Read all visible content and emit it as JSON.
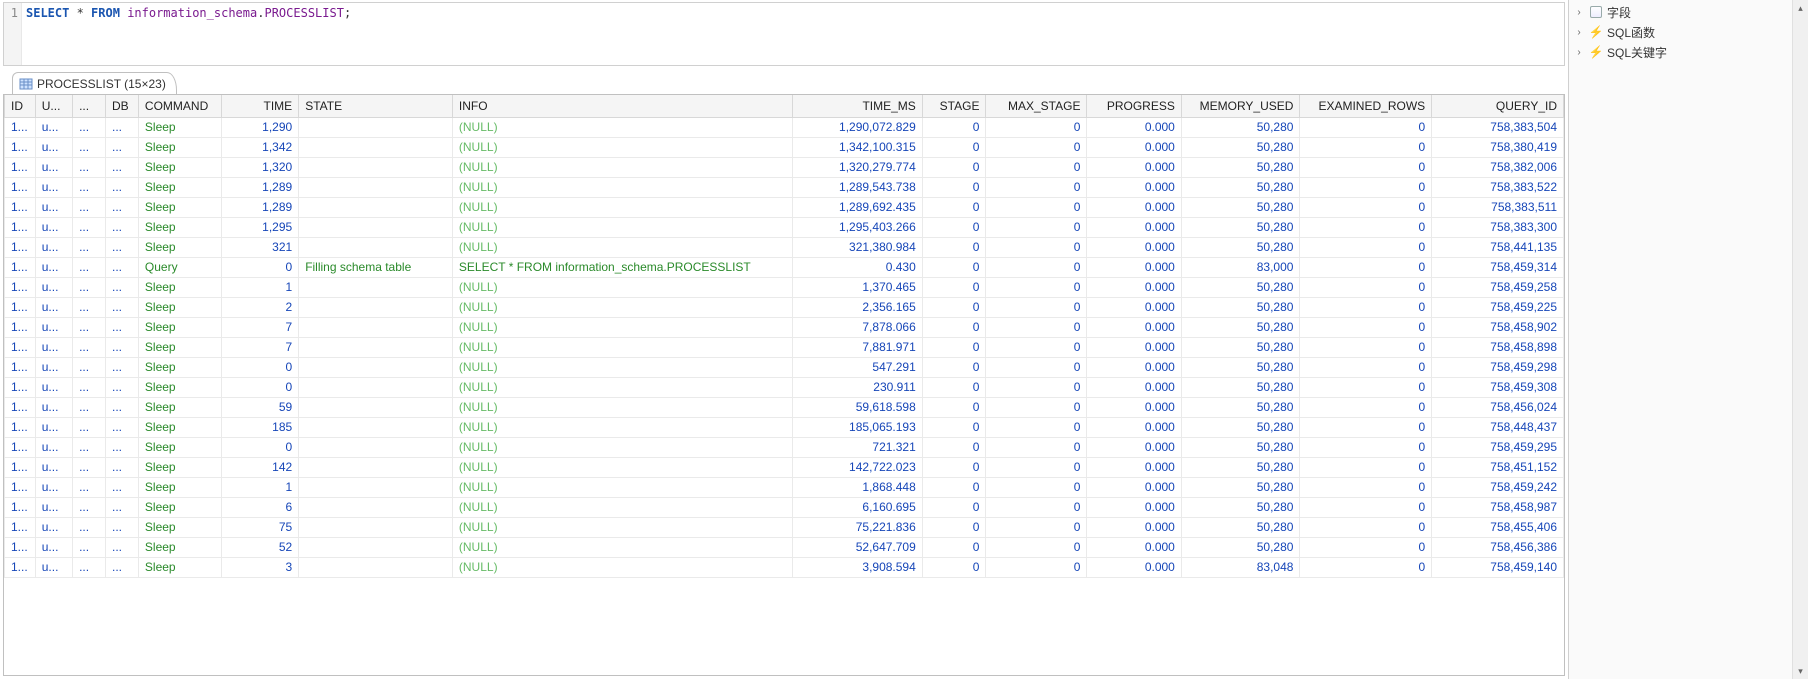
{
  "editor": {
    "line_number": "1",
    "kw_select": "SELECT",
    "star": " * ",
    "kw_from": "FROM",
    "space": " ",
    "id_schema": "information_schema",
    "dot": ".",
    "id_table": "PROCESSLIST",
    "semi": ";"
  },
  "tab": {
    "label": "PROCESSLIST (15×23)"
  },
  "sidebar": {
    "items": [
      {
        "label": "字段",
        "icon": "db"
      },
      {
        "label": "SQL函数",
        "icon": "bolt"
      },
      {
        "label": "SQL关键字",
        "icon": "bolt"
      }
    ]
  },
  "columns": [
    "ID",
    "U...",
    "...",
    "DB",
    "COMMAND",
    "TIME",
    "STATE",
    "INFO",
    "TIME_MS",
    "STAGE",
    "MAX_STAGE",
    "PROGRESS",
    "MEMORY_USED",
    "EXAMINED_ROWS",
    "QUERY_ID"
  ],
  "rows": [
    {
      "id": "1...",
      "u": "u...",
      "b1": "...",
      "b2": "...",
      "cmd": "Sleep",
      "time": "1,290",
      "state": "",
      "info": "(NULL)",
      "info_null": true,
      "tms": "1,290,072.829",
      "stage": "0",
      "max": "0",
      "prog": "0.000",
      "mem": "50,280",
      "exr": "0",
      "qid": "758,383,504"
    },
    {
      "id": "1...",
      "u": "u...",
      "b1": "...",
      "b2": "...",
      "cmd": "Sleep",
      "time": "1,342",
      "state": "",
      "info": "(NULL)",
      "info_null": true,
      "tms": "1,342,100.315",
      "stage": "0",
      "max": "0",
      "prog": "0.000",
      "mem": "50,280",
      "exr": "0",
      "qid": "758,380,419"
    },
    {
      "id": "1...",
      "u": "u...",
      "b1": "...",
      "b2": "...",
      "cmd": "Sleep",
      "time": "1,320",
      "state": "",
      "info": "(NULL)",
      "info_null": true,
      "tms": "1,320,279.774",
      "stage": "0",
      "max": "0",
      "prog": "0.000",
      "mem": "50,280",
      "exr": "0",
      "qid": "758,382,006"
    },
    {
      "id": "1...",
      "u": "u...",
      "b1": "...",
      "b2": "...",
      "cmd": "Sleep",
      "time": "1,289",
      "state": "",
      "info": "(NULL)",
      "info_null": true,
      "tms": "1,289,543.738",
      "stage": "0",
      "max": "0",
      "prog": "0.000",
      "mem": "50,280",
      "exr": "0",
      "qid": "758,383,522"
    },
    {
      "id": "1...",
      "u": "u...",
      "b1": "...",
      "b2": "...",
      "cmd": "Sleep",
      "time": "1,289",
      "state": "",
      "info": "(NULL)",
      "info_null": true,
      "tms": "1,289,692.435",
      "stage": "0",
      "max": "0",
      "prog": "0.000",
      "mem": "50,280",
      "exr": "0",
      "qid": "758,383,511"
    },
    {
      "id": "1...",
      "u": "u...",
      "b1": "...",
      "b2": "...",
      "cmd": "Sleep",
      "time": "1,295",
      "state": "",
      "info": "(NULL)",
      "info_null": true,
      "tms": "1,295,403.266",
      "stage": "0",
      "max": "0",
      "prog": "0.000",
      "mem": "50,280",
      "exr": "0",
      "qid": "758,383,300"
    },
    {
      "id": "1...",
      "u": "u...",
      "b1": "...",
      "b2": "...",
      "cmd": "Sleep",
      "time": "321",
      "state": "",
      "info": "(NULL)",
      "info_null": true,
      "tms": "321,380.984",
      "stage": "0",
      "max": "0",
      "prog": "0.000",
      "mem": "50,280",
      "exr": "0",
      "qid": "758,441,135"
    },
    {
      "id": "1...",
      "u": "u...",
      "b1": "...",
      "b2": "...",
      "cmd": "Query",
      "time": "0",
      "state": "Filling schema table",
      "info": "SELECT * FROM information_schema.PROCESSLIST",
      "info_null": false,
      "tms": "0.430",
      "stage": "0",
      "max": "0",
      "prog": "0.000",
      "mem": "83,000",
      "exr": "0",
      "qid": "758,459,314"
    },
    {
      "id": "1...",
      "u": "u...",
      "b1": "...",
      "b2": "...",
      "cmd": "Sleep",
      "time": "1",
      "state": "",
      "info": "(NULL)",
      "info_null": true,
      "tms": "1,370.465",
      "stage": "0",
      "max": "0",
      "prog": "0.000",
      "mem": "50,280",
      "exr": "0",
      "qid": "758,459,258"
    },
    {
      "id": "1...",
      "u": "u...",
      "b1": "...",
      "b2": "...",
      "cmd": "Sleep",
      "time": "2",
      "state": "",
      "info": "(NULL)",
      "info_null": true,
      "tms": "2,356.165",
      "stage": "0",
      "max": "0",
      "prog": "0.000",
      "mem": "50,280",
      "exr": "0",
      "qid": "758,459,225"
    },
    {
      "id": "1...",
      "u": "u...",
      "b1": "...",
      "b2": "...",
      "cmd": "Sleep",
      "time": "7",
      "state": "",
      "info": "(NULL)",
      "info_null": true,
      "tms": "7,878.066",
      "stage": "0",
      "max": "0",
      "prog": "0.000",
      "mem": "50,280",
      "exr": "0",
      "qid": "758,458,902"
    },
    {
      "id": "1...",
      "u": "u...",
      "b1": "...",
      "b2": "...",
      "cmd": "Sleep",
      "time": "7",
      "state": "",
      "info": "(NULL)",
      "info_null": true,
      "tms": "7,881.971",
      "stage": "0",
      "max": "0",
      "prog": "0.000",
      "mem": "50,280",
      "exr": "0",
      "qid": "758,458,898"
    },
    {
      "id": "1...",
      "u": "u...",
      "b1": "...",
      "b2": "...",
      "cmd": "Sleep",
      "time": "0",
      "state": "",
      "info": "(NULL)",
      "info_null": true,
      "tms": "547.291",
      "stage": "0",
      "max": "0",
      "prog": "0.000",
      "mem": "50,280",
      "exr": "0",
      "qid": "758,459,298"
    },
    {
      "id": "1...",
      "u": "u...",
      "b1": "...",
      "b2": "...",
      "cmd": "Sleep",
      "time": "0",
      "state": "",
      "info": "(NULL)",
      "info_null": true,
      "tms": "230.911",
      "stage": "0",
      "max": "0",
      "prog": "0.000",
      "mem": "50,280",
      "exr": "0",
      "qid": "758,459,308"
    },
    {
      "id": "1...",
      "u": "u...",
      "b1": "...",
      "b2": "...",
      "cmd": "Sleep",
      "time": "59",
      "state": "",
      "info": "(NULL)",
      "info_null": true,
      "tms": "59,618.598",
      "stage": "0",
      "max": "0",
      "prog": "0.000",
      "mem": "50,280",
      "exr": "0",
      "qid": "758,456,024"
    },
    {
      "id": "1...",
      "u": "u...",
      "b1": "...",
      "b2": "...",
      "cmd": "Sleep",
      "time": "185",
      "state": "",
      "info": "(NULL)",
      "info_null": true,
      "tms": "185,065.193",
      "stage": "0",
      "max": "0",
      "prog": "0.000",
      "mem": "50,280",
      "exr": "0",
      "qid": "758,448,437"
    },
    {
      "id": "1...",
      "u": "u...",
      "b1": "...",
      "b2": "...",
      "cmd": "Sleep",
      "time": "0",
      "state": "",
      "info": "(NULL)",
      "info_null": true,
      "tms": "721.321",
      "stage": "0",
      "max": "0",
      "prog": "0.000",
      "mem": "50,280",
      "exr": "0",
      "qid": "758,459,295"
    },
    {
      "id": "1...",
      "u": "u...",
      "b1": "...",
      "b2": "...",
      "cmd": "Sleep",
      "time": "142",
      "state": "",
      "info": "(NULL)",
      "info_null": true,
      "tms": "142,722.023",
      "stage": "0",
      "max": "0",
      "prog": "0.000",
      "mem": "50,280",
      "exr": "0",
      "qid": "758,451,152"
    },
    {
      "id": "1...",
      "u": "u...",
      "b1": "...",
      "b2": "...",
      "cmd": "Sleep",
      "time": "1",
      "state": "",
      "info": "(NULL)",
      "info_null": true,
      "tms": "1,868.448",
      "stage": "0",
      "max": "0",
      "prog": "0.000",
      "mem": "50,280",
      "exr": "0",
      "qid": "758,459,242"
    },
    {
      "id": "1...",
      "u": "u...",
      "b1": "...",
      "b2": "...",
      "cmd": "Sleep",
      "time": "6",
      "state": "",
      "info": "(NULL)",
      "info_null": true,
      "tms": "6,160.695",
      "stage": "0",
      "max": "0",
      "prog": "0.000",
      "mem": "50,280",
      "exr": "0",
      "qid": "758,458,987"
    },
    {
      "id": "1...",
      "u": "u...",
      "b1": "...",
      "b2": "...",
      "cmd": "Sleep",
      "time": "75",
      "state": "",
      "info": "(NULL)",
      "info_null": true,
      "tms": "75,221.836",
      "stage": "0",
      "max": "0",
      "prog": "0.000",
      "mem": "50,280",
      "exr": "0",
      "qid": "758,455,406"
    },
    {
      "id": "1...",
      "u": "u...",
      "b1": "...",
      "b2": "...",
      "cmd": "Sleep",
      "time": "52",
      "state": "",
      "info": "(NULL)",
      "info_null": true,
      "tms": "52,647.709",
      "stage": "0",
      "max": "0",
      "prog": "0.000",
      "mem": "50,280",
      "exr": "0",
      "qid": "758,456,386"
    },
    {
      "id": "1...",
      "u": "u...",
      "b1": "...",
      "b2": "...",
      "cmd": "Sleep",
      "time": "3",
      "state": "",
      "info": "(NULL)",
      "info_null": true,
      "tms": "3,908.594",
      "stage": "0",
      "max": "0",
      "prog": "0.000",
      "mem": "83,048",
      "exr": "0",
      "qid": "758,459,140"
    }
  ]
}
